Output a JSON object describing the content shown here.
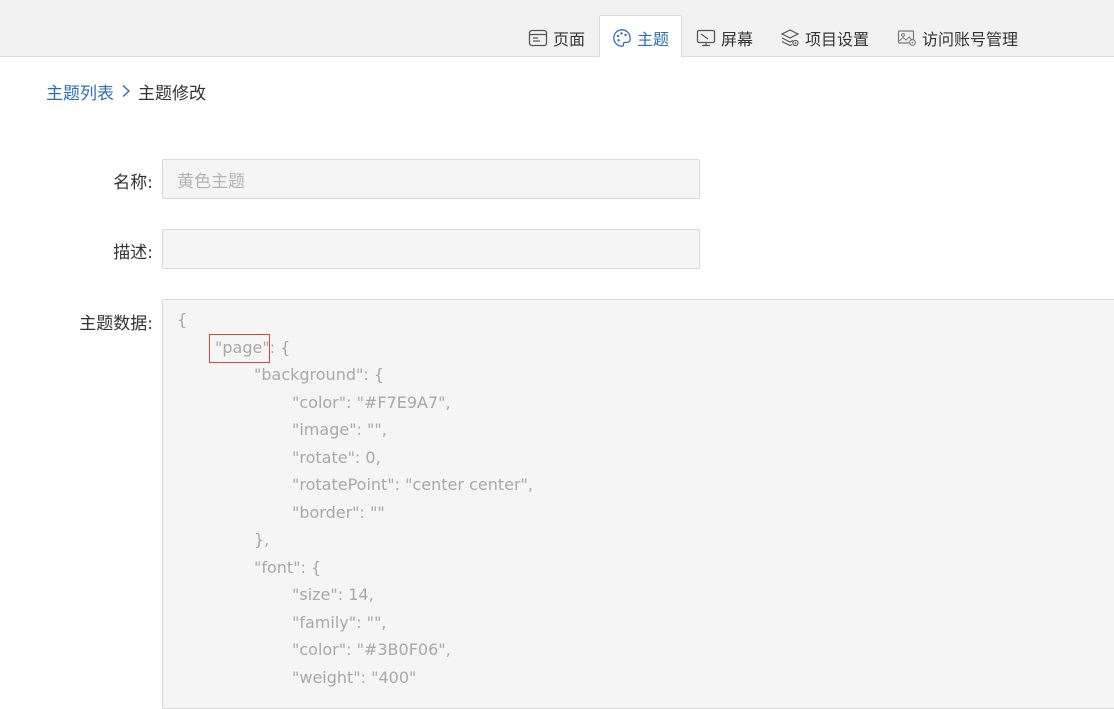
{
  "tabs": [
    {
      "label": "页面",
      "icon": "page-icon",
      "active": false
    },
    {
      "label": "主题",
      "icon": "palette-icon",
      "active": true
    },
    {
      "label": "屏幕",
      "icon": "screen-icon",
      "active": false
    },
    {
      "label": "项目设置",
      "icon": "layers-settings-icon",
      "active": false
    },
    {
      "label": "访问账号管理",
      "icon": "account-image-icon",
      "active": false
    }
  ],
  "breadcrumb": {
    "parent": "主题列表",
    "separator_icon": "chevron-right-icon",
    "current": "主题修改"
  },
  "form": {
    "name_label": "名称:",
    "name_value": "黄色主题",
    "desc_label": "描述:",
    "desc_value": "",
    "data_label": "主题数据:"
  },
  "code_lines": [
    "{",
    "\"page\": {",
    "\"background\": {",
    "\"color\": \"#F7E9A7\",",
    "\"image\": \"\",",
    "\"rotate\": 0,",
    "\"rotatePoint\": \"center center\",",
    "\"border\": \"\"",
    "},",
    "\"font\": {",
    "\"size\": 14,",
    "\"family\": \"\",",
    "\"color\": \"#3B0F06\",",
    "\"weight\": \"400\""
  ],
  "colors": {
    "accent": "#2d6eb8",
    "highlight_border": "#e0403a",
    "code_text": "#a8a8a8"
  }
}
